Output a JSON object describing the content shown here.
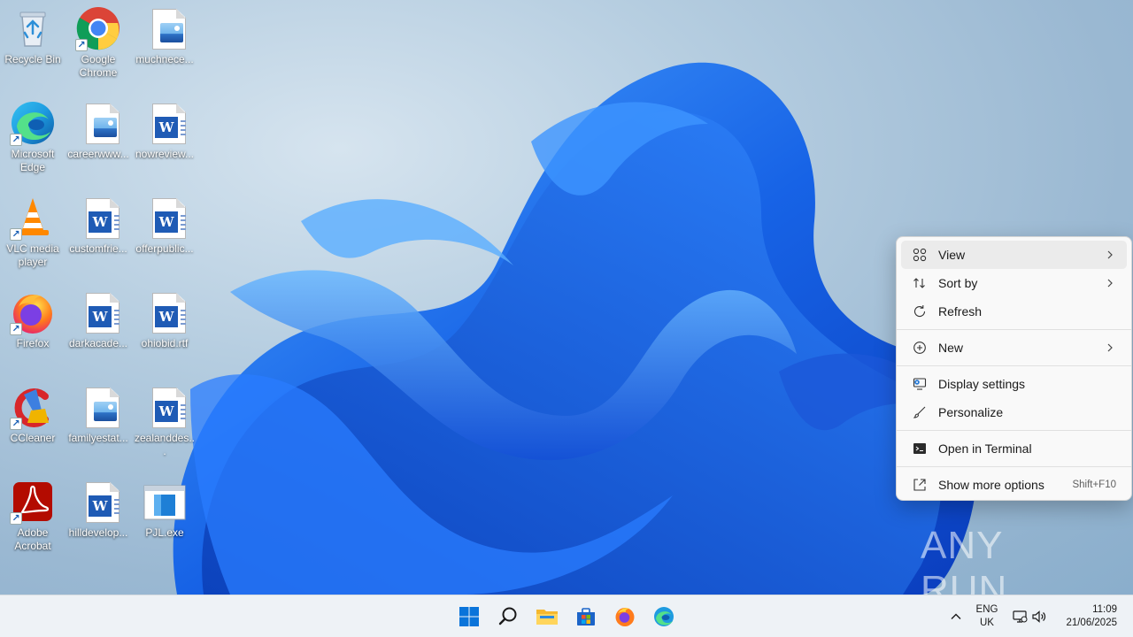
{
  "desktop": {
    "icons": [
      {
        "label": "Recycle Bin",
        "icon": "recycle-bin-icon"
      },
      {
        "label": "Google Chrome",
        "icon": "chrome-icon"
      },
      {
        "label": "muchnece...",
        "icon": "image-file-icon"
      },
      {
        "label": "Microsoft Edge",
        "icon": "edge-icon"
      },
      {
        "label": "careerwww...",
        "icon": "image-file-icon"
      },
      {
        "label": "nowreview...",
        "icon": "word-document-icon"
      },
      {
        "label": "VLC media player",
        "icon": "vlc-icon"
      },
      {
        "label": "customfrie...",
        "icon": "word-document-icon"
      },
      {
        "label": "offerpublic...",
        "icon": "word-document-icon"
      },
      {
        "label": "Firefox",
        "icon": "firefox-icon"
      },
      {
        "label": "darkacade...",
        "icon": "word-document-icon"
      },
      {
        "label": "ohiobid.rtf",
        "icon": "word-document-icon"
      },
      {
        "label": "CCleaner",
        "icon": "ccleaner-icon"
      },
      {
        "label": "familyestat...",
        "icon": "image-file-icon"
      },
      {
        "label": "zealanddes...",
        "icon": "word-document-icon"
      },
      {
        "label": "Adobe Acrobat",
        "icon": "acrobat-icon"
      },
      {
        "label": "hilldevelop...",
        "icon": "word-document-icon"
      },
      {
        "label": "PJL.exe",
        "icon": "exe-file-icon"
      }
    ]
  },
  "context_menu": {
    "items": [
      {
        "label": "View",
        "icon": "view-grid-icon",
        "submenu": true,
        "accel": ""
      },
      {
        "label": "Sort by",
        "icon": "sort-icon",
        "submenu": true,
        "accel": ""
      },
      {
        "label": "Refresh",
        "icon": "refresh-icon",
        "submenu": false,
        "accel": ""
      },
      {
        "label": "New",
        "icon": "new-plus-icon",
        "submenu": true,
        "accel": ""
      },
      {
        "label": "Display settings",
        "icon": "display-settings-icon",
        "submenu": false,
        "accel": ""
      },
      {
        "label": "Personalize",
        "icon": "personalize-brush-icon",
        "submenu": false,
        "accel": ""
      },
      {
        "label": "Open in Terminal",
        "icon": "terminal-icon",
        "submenu": false,
        "accel": ""
      },
      {
        "label": "Show more options",
        "icon": "show-more-options-icon",
        "submenu": false,
        "accel": "Shift+F10"
      }
    ]
  },
  "taskbar": {
    "pinned": [
      "windows-start-icon",
      "search-icon",
      "file-explorer-icon",
      "microsoft-store-icon",
      "firefox-icon",
      "edge-icon"
    ],
    "tray": {
      "language_line1": "ENG",
      "language_line2": "UK",
      "time": "11:09",
      "date": "21/06/2025"
    }
  },
  "watermark": {
    "text": "ANY RUN"
  },
  "colors": {
    "accent": "#0067c0",
    "wallpaper_blue": "#1a5fe0",
    "menu_bg": "#f9f9f9"
  }
}
